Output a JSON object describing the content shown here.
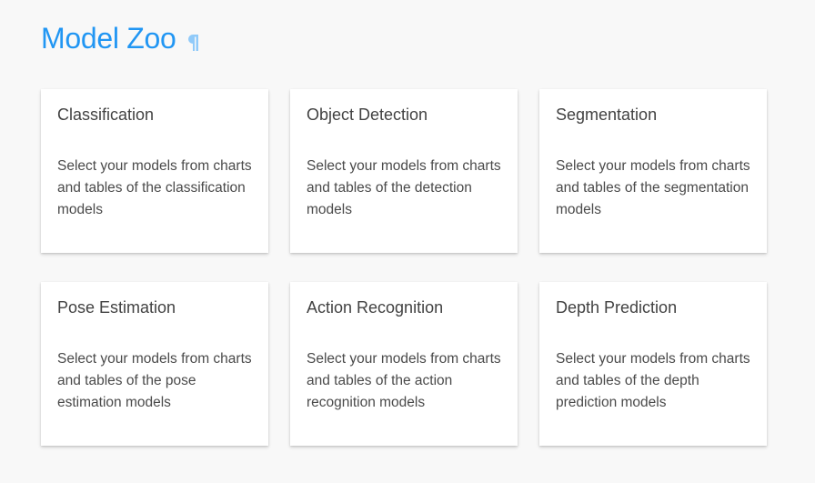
{
  "page": {
    "title": "Model Zoo",
    "anchor_icon": "pilcrow-icon",
    "accent_color": "#2196f3",
    "anchor_color": "#90caf9"
  },
  "cards": [
    {
      "title": "Classification",
      "description": "Select your models from charts and tables of the classification models"
    },
    {
      "title": "Object Detection",
      "description": "Select your models from charts and tables of the detection models"
    },
    {
      "title": "Segmentation",
      "description": "Select your models from charts and tables of the segmentation models"
    },
    {
      "title": "Pose Estimation",
      "description": "Select your models from charts and tables of the pose estimation models"
    },
    {
      "title": "Action Recognition",
      "description": "Select your models from charts and tables of the action recognition models"
    },
    {
      "title": "Depth Prediction",
      "description": "Select your models from charts and tables of the depth prediction models"
    }
  ]
}
